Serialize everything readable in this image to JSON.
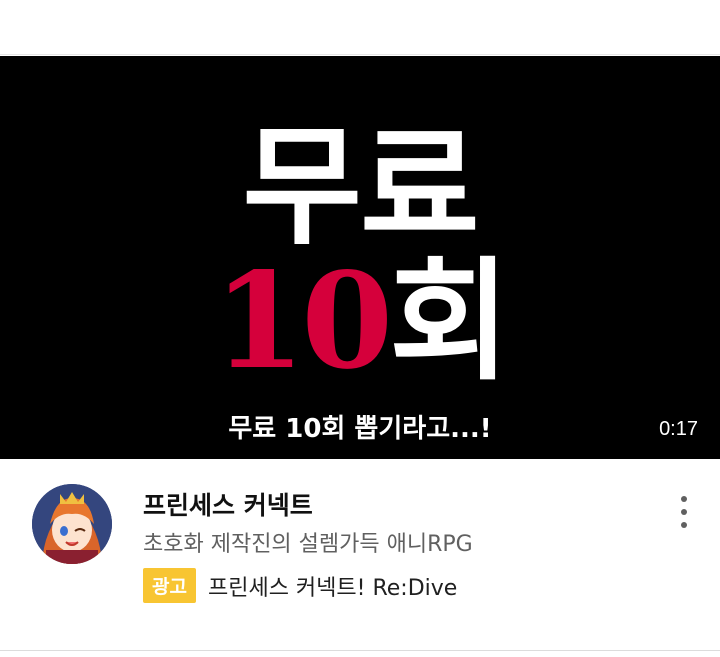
{
  "video": {
    "headline_line1": "무료",
    "headline_line2_number": "10",
    "headline_line2_text": "회",
    "caption": "무료 10회 뽑기라고...!",
    "duration": "0:17",
    "colors": {
      "background": "#000000",
      "accent": "#d5003b"
    }
  },
  "ad": {
    "channel_title": "프린세스 커넥트",
    "description": "초호화 제작진의 설렘가득 애니RPG",
    "badge": "광고",
    "app_name": "프린세스 커넥트! Re:Dive",
    "badge_color": "#f8c532"
  },
  "icons": {
    "avatar": "anime-character-avatar",
    "more": "more-vert-icon"
  }
}
